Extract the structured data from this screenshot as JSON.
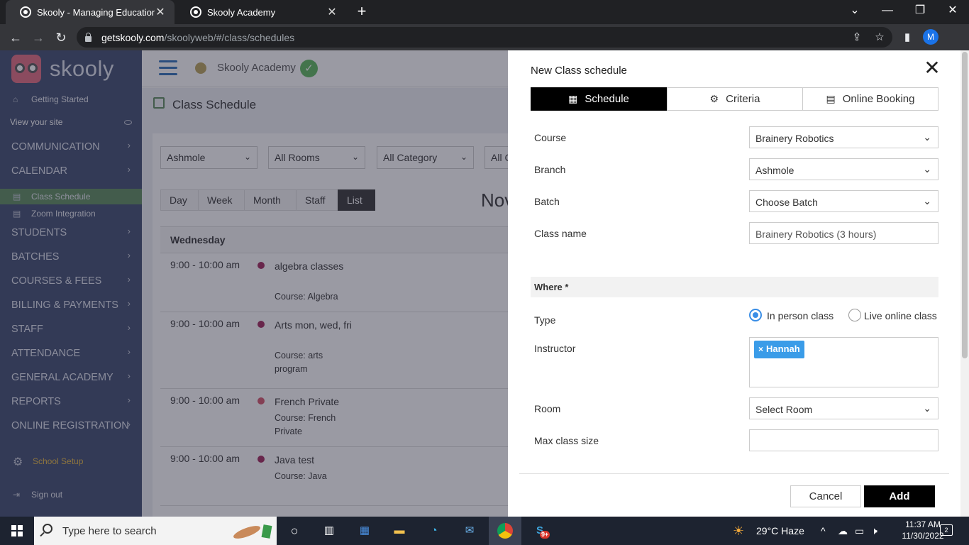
{
  "browser": {
    "tabs": [
      {
        "title": "Skooly - Managing Educational Institutions",
        "active": true
      },
      {
        "title": "Skooly Academy",
        "active": false
      }
    ],
    "url_host": "getskooly.com",
    "url_path": "/skoolyweb/#/class/schedules",
    "profile_initial": "M"
  },
  "sidebar": {
    "brand": "skooly",
    "getting_started": "Getting Started",
    "view_site": "View your site",
    "menu": [
      "COMMUNICATION",
      "CALENDAR",
      "STUDENTS",
      "BATCHES",
      "COURSES & FEES",
      "BILLING & PAYMENTS",
      "STAFF",
      "ATTENDANCE",
      "GENERAL ACADEMY",
      "REPORTS",
      "ONLINE REGISTRATION"
    ],
    "submenu": [
      "Class Schedule",
      "Zoom Integration"
    ],
    "school_setup": "School Setup",
    "sign_out": "Sign out"
  },
  "header": {
    "academy_name": "Skooly Academy"
  },
  "page": {
    "title": "Class Schedule",
    "filters": [
      "Ashmole",
      "All Rooms",
      "All Category",
      "All C"
    ],
    "view_tabs": [
      "Day",
      "Week",
      "Month",
      "Staff",
      "List"
    ],
    "active_view": "List",
    "month_title": "Nov",
    "day_header": "Wednesday",
    "events": [
      {
        "time": "9:00 - 10:00 am",
        "title": "algebra classes",
        "course": "Course: Algebra",
        "color": "#a0245a"
      },
      {
        "time": "9:00 - 10:00 am",
        "title": "Arts mon, wed, fri",
        "course": "Course: arts program",
        "color": "#a0245a"
      },
      {
        "time": "9:00 - 10:00 am",
        "title": "French Private",
        "course": "Course: French Private",
        "color": "#d6546b"
      },
      {
        "time": "9:00 - 10:00 am",
        "title": "Java test",
        "course": "Course: Java",
        "color": "#a0245a"
      }
    ]
  },
  "dialog": {
    "title": "New Class schedule",
    "tabs": [
      "Schedule",
      "Criteria",
      "Online Booking"
    ],
    "fields": {
      "course_label": "Course",
      "course_value": "Brainery Robotics",
      "branch_label": "Branch",
      "branch_value": "Ashmole",
      "batch_label": "Batch",
      "batch_value": "Choose Batch",
      "class_name_label": "Class name",
      "class_name_value": "Brainery Robotics (3 hours)",
      "where_section": "Where *",
      "type_label": "Type",
      "type_option_in_person": "In person class",
      "type_option_online": "Live online class",
      "type_selected": "In person class",
      "instructor_label": "Instructor",
      "instructor_chip": "Hannah",
      "room_label": "Room",
      "room_value": "Select Room",
      "max_size_label": "Max class size",
      "max_size_value": ""
    },
    "cancel_label": "Cancel",
    "add_label": "Add"
  },
  "taskbar": {
    "search_placeholder": "Type here to search",
    "weather": "29°C  Haze",
    "time": "11:37 AM",
    "date": "11/30/2022",
    "notifications": "2",
    "skype_badge": "9+"
  }
}
